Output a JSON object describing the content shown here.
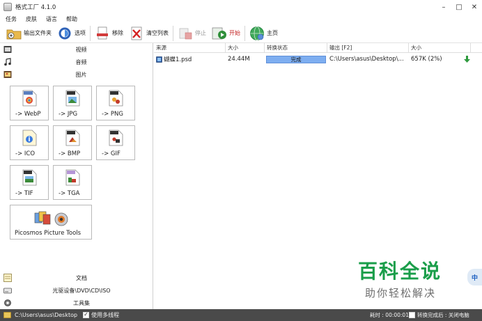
{
  "window": {
    "title": "格式工厂 4.1.0",
    "controls": [
      "–",
      "□",
      "✕"
    ]
  },
  "menu": {
    "items": [
      "任务",
      "皮肤",
      "语言",
      "帮助"
    ]
  },
  "toolbar": {
    "output_folder": "输出文件夹",
    "options": "选项",
    "remove": "移除",
    "clear_list": "清空列表",
    "stop": "停止",
    "start": "开始",
    "home": "主页"
  },
  "categories": {
    "video": "视频",
    "audio": "音频",
    "picture": "图片",
    "document": "文档",
    "rom": "光驱设备\\DVD\\CD\\ISO",
    "tools": "工具集"
  },
  "tiles": [
    {
      "label": "-> WebP",
      "badge": "WebP"
    },
    {
      "label": "-> JPG",
      "badge": "JPG"
    },
    {
      "label": "-> PNG",
      "badge": "PNG"
    },
    {
      "label": "-> ICO",
      "badge": ""
    },
    {
      "label": "-> BMP",
      "badge": "BMP"
    },
    {
      "label": "-> GIF",
      "badge": "GIF"
    },
    {
      "label": "-> TIF",
      "badge": "TIF"
    },
    {
      "label": "-> TGA",
      "badge": "TGA"
    }
  ],
  "picosmos": {
    "label": "Picosmos Picture Tools"
  },
  "list": {
    "columns": [
      "来源",
      "大小",
      "转换状态",
      "输出 [F2]",
      "大小"
    ],
    "rows": [
      {
        "source": "蝴蝶1.psd",
        "size": "24.44M",
        "status": "完成",
        "output": "C:\\Users\\asus\\Desktop\\...",
        "out_size": "657K (2%)"
      }
    ]
  },
  "statusbar": {
    "path": "C:\\Users\\asus\\Desktop",
    "multithread": "使用多线程",
    "elapsed": "耗时 : 00:00:01",
    "after_done": "转换完成后 : 关闭电脑"
  },
  "watermark": {
    "main": "百科全说",
    "sub": "助你轻松解决",
    "badge": "中"
  },
  "colors": {
    "status_done": "#7eaef0",
    "start_label": "#c21d1d",
    "statusbar_bg": "#4a4a4a",
    "watermark": "#1a9e4a"
  }
}
